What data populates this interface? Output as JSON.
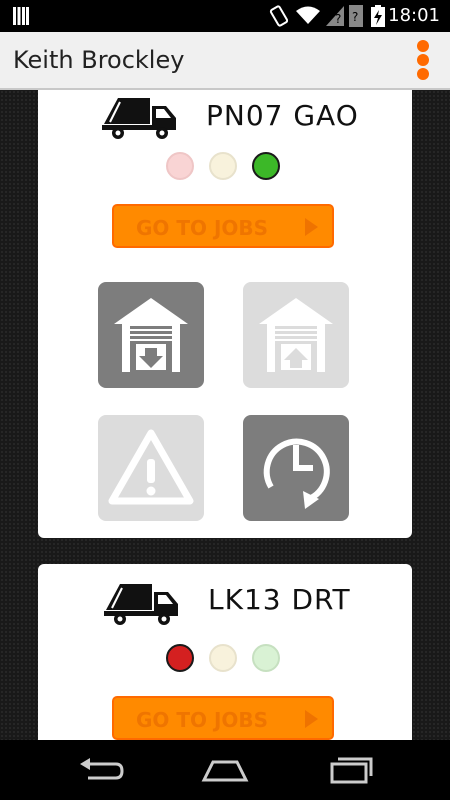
{
  "status_bar": {
    "time": "18:01"
  },
  "app_bar": {
    "title": "Keith Brockley"
  },
  "vehicles": [
    {
      "registration": "PN07 GAO",
      "lights": {
        "red": false,
        "amber": false,
        "green": true
      },
      "go_to_jobs_label": "GO TO JOBS",
      "actions": {
        "depot_in_enabled": true,
        "depot_out_enabled": false,
        "warning_enabled": false,
        "history_enabled": true
      }
    },
    {
      "registration": "LK13 DRT",
      "lights": {
        "red": true,
        "amber": false,
        "green": false
      },
      "go_to_jobs_label": "GO TO JOBS"
    }
  ],
  "colors": {
    "accent": "#ff6a00",
    "button": "#ff8a00",
    "light_red_on": "#d42020",
    "light_green_on": "#3cb828",
    "tile_active": "#7d7d7d",
    "tile_disabled": "#dcdcdc"
  },
  "icons": {
    "vehicle": "garbage-truck-icon",
    "depot_in": "garage-arrow-down-icon",
    "depot_out": "garage-arrow-up-icon",
    "warning": "warning-triangle-icon",
    "history": "clock-history-icon",
    "menu": "overflow-menu-icon",
    "back": "back-icon",
    "home": "home-icon",
    "recents": "recents-icon"
  }
}
